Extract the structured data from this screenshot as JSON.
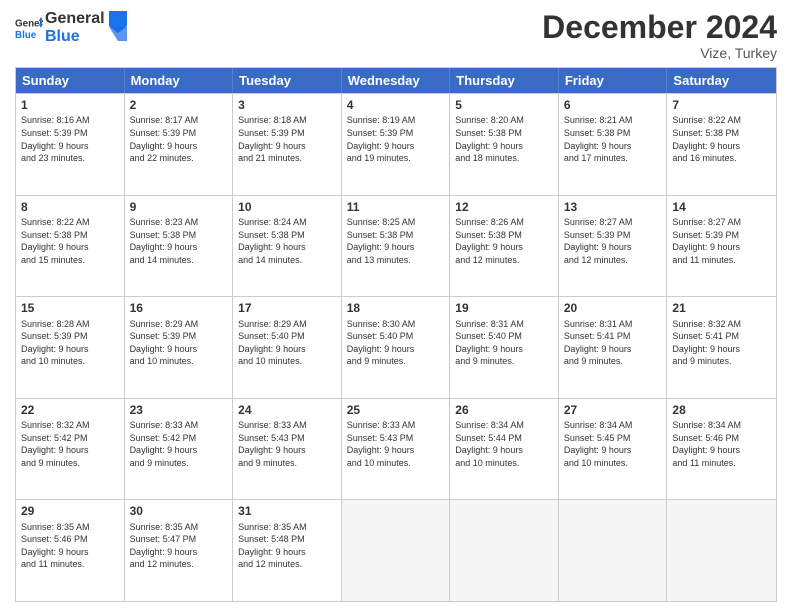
{
  "header": {
    "logo_line1": "General",
    "logo_line2": "Blue",
    "month_title": "December 2024",
    "location": "Vize, Turkey"
  },
  "days_of_week": [
    "Sunday",
    "Monday",
    "Tuesday",
    "Wednesday",
    "Thursday",
    "Friday",
    "Saturday"
  ],
  "weeks": [
    [
      {
        "day": "1",
        "info": "Sunrise: 8:16 AM\nSunset: 5:39 PM\nDaylight: 9 hours\nand 23 minutes."
      },
      {
        "day": "2",
        "info": "Sunrise: 8:17 AM\nSunset: 5:39 PM\nDaylight: 9 hours\nand 22 minutes."
      },
      {
        "day": "3",
        "info": "Sunrise: 8:18 AM\nSunset: 5:39 PM\nDaylight: 9 hours\nand 21 minutes."
      },
      {
        "day": "4",
        "info": "Sunrise: 8:19 AM\nSunset: 5:39 PM\nDaylight: 9 hours\nand 19 minutes."
      },
      {
        "day": "5",
        "info": "Sunrise: 8:20 AM\nSunset: 5:38 PM\nDaylight: 9 hours\nand 18 minutes."
      },
      {
        "day": "6",
        "info": "Sunrise: 8:21 AM\nSunset: 5:38 PM\nDaylight: 9 hours\nand 17 minutes."
      },
      {
        "day": "7",
        "info": "Sunrise: 8:22 AM\nSunset: 5:38 PM\nDaylight: 9 hours\nand 16 minutes."
      }
    ],
    [
      {
        "day": "8",
        "info": "Sunrise: 8:22 AM\nSunset: 5:38 PM\nDaylight: 9 hours\nand 15 minutes."
      },
      {
        "day": "9",
        "info": "Sunrise: 8:23 AM\nSunset: 5:38 PM\nDaylight: 9 hours\nand 14 minutes."
      },
      {
        "day": "10",
        "info": "Sunrise: 8:24 AM\nSunset: 5:38 PM\nDaylight: 9 hours\nand 14 minutes."
      },
      {
        "day": "11",
        "info": "Sunrise: 8:25 AM\nSunset: 5:38 PM\nDaylight: 9 hours\nand 13 minutes."
      },
      {
        "day": "12",
        "info": "Sunrise: 8:26 AM\nSunset: 5:38 PM\nDaylight: 9 hours\nand 12 minutes."
      },
      {
        "day": "13",
        "info": "Sunrise: 8:27 AM\nSunset: 5:39 PM\nDaylight: 9 hours\nand 12 minutes."
      },
      {
        "day": "14",
        "info": "Sunrise: 8:27 AM\nSunset: 5:39 PM\nDaylight: 9 hours\nand 11 minutes."
      }
    ],
    [
      {
        "day": "15",
        "info": "Sunrise: 8:28 AM\nSunset: 5:39 PM\nDaylight: 9 hours\nand 10 minutes."
      },
      {
        "day": "16",
        "info": "Sunrise: 8:29 AM\nSunset: 5:39 PM\nDaylight: 9 hours\nand 10 minutes."
      },
      {
        "day": "17",
        "info": "Sunrise: 8:29 AM\nSunset: 5:40 PM\nDaylight: 9 hours\nand 10 minutes."
      },
      {
        "day": "18",
        "info": "Sunrise: 8:30 AM\nSunset: 5:40 PM\nDaylight: 9 hours\nand 9 minutes."
      },
      {
        "day": "19",
        "info": "Sunrise: 8:31 AM\nSunset: 5:40 PM\nDaylight: 9 hours\nand 9 minutes."
      },
      {
        "day": "20",
        "info": "Sunrise: 8:31 AM\nSunset: 5:41 PM\nDaylight: 9 hours\nand 9 minutes."
      },
      {
        "day": "21",
        "info": "Sunrise: 8:32 AM\nSunset: 5:41 PM\nDaylight: 9 hours\nand 9 minutes."
      }
    ],
    [
      {
        "day": "22",
        "info": "Sunrise: 8:32 AM\nSunset: 5:42 PM\nDaylight: 9 hours\nand 9 minutes."
      },
      {
        "day": "23",
        "info": "Sunrise: 8:33 AM\nSunset: 5:42 PM\nDaylight: 9 hours\nand 9 minutes."
      },
      {
        "day": "24",
        "info": "Sunrise: 8:33 AM\nSunset: 5:43 PM\nDaylight: 9 hours\nand 9 minutes."
      },
      {
        "day": "25",
        "info": "Sunrise: 8:33 AM\nSunset: 5:43 PM\nDaylight: 9 hours\nand 10 minutes."
      },
      {
        "day": "26",
        "info": "Sunrise: 8:34 AM\nSunset: 5:44 PM\nDaylight: 9 hours\nand 10 minutes."
      },
      {
        "day": "27",
        "info": "Sunrise: 8:34 AM\nSunset: 5:45 PM\nDaylight: 9 hours\nand 10 minutes."
      },
      {
        "day": "28",
        "info": "Sunrise: 8:34 AM\nSunset: 5:46 PM\nDaylight: 9 hours\nand 11 minutes."
      }
    ],
    [
      {
        "day": "29",
        "info": "Sunrise: 8:35 AM\nSunset: 5:46 PM\nDaylight: 9 hours\nand 11 minutes."
      },
      {
        "day": "30",
        "info": "Sunrise: 8:35 AM\nSunset: 5:47 PM\nDaylight: 9 hours\nand 12 minutes."
      },
      {
        "day": "31",
        "info": "Sunrise: 8:35 AM\nSunset: 5:48 PM\nDaylight: 9 hours\nand 12 minutes."
      },
      {
        "day": "",
        "info": ""
      },
      {
        "day": "",
        "info": ""
      },
      {
        "day": "",
        "info": ""
      },
      {
        "day": "",
        "info": ""
      }
    ]
  ]
}
